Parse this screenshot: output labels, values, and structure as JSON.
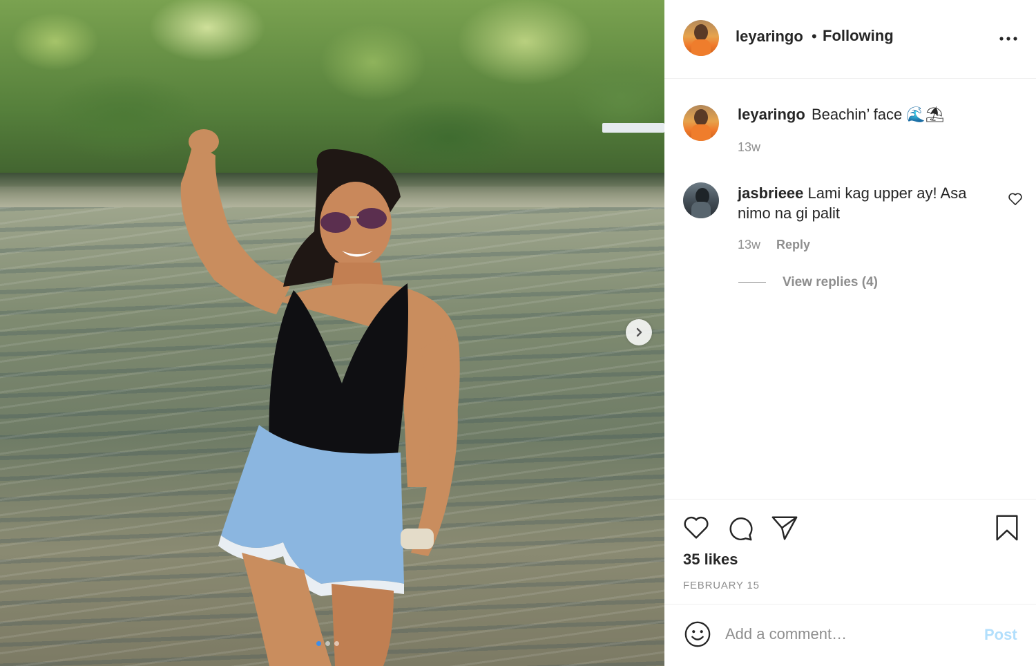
{
  "post": {
    "username": "leyaringo",
    "separator": "•",
    "follow_status": "Following"
  },
  "caption": {
    "username": "leyaringo",
    "text": "Beachin’ face 🌊⛱",
    "time": "13w"
  },
  "comments": [
    {
      "username": "jasbrieee",
      "text": "Lami kag upper ay! Asa nimo na gi palit",
      "time": "13w",
      "reply_label": "Reply",
      "view_replies_label": "View replies (4)"
    }
  ],
  "engagement": {
    "likes": "35 likes",
    "date": "FEBRUARY 15"
  },
  "composer": {
    "placeholder": "Add a comment…",
    "post_label": "Post"
  },
  "carousel": {
    "slide_count": 3,
    "active_index": 0
  },
  "icons": {
    "more": "more-horizontal-icon",
    "like": "heart-icon",
    "comment": "comment-bubble-icon",
    "share": "paper-plane-icon",
    "save": "bookmark-icon",
    "emoji": "smiley-icon",
    "next": "chevron-right-icon"
  },
  "colors": {
    "text": "#262626",
    "muted": "#8e8e8e",
    "post_disabled": "#b2dffc",
    "carousel_active": "#3f8ee8"
  }
}
